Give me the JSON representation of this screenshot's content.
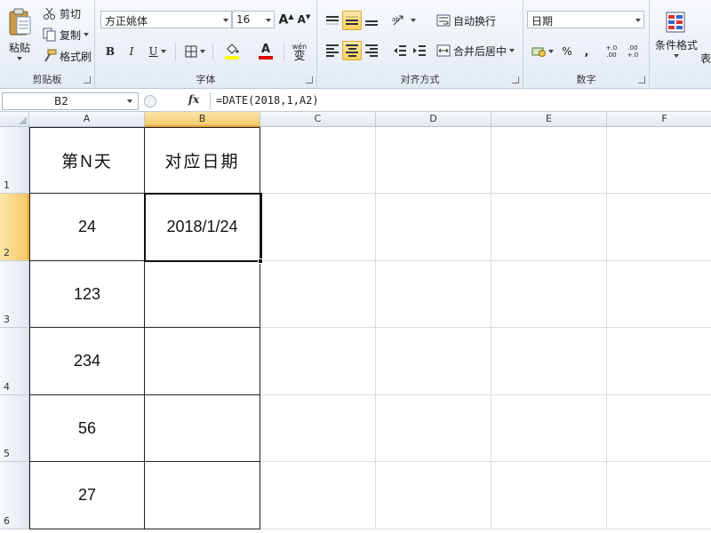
{
  "ribbon": {
    "clipboard": {
      "label": "剪贴板",
      "paste": "粘贴",
      "cut": "剪切",
      "copy": "复制",
      "format_painter": "格式刷"
    },
    "font": {
      "label": "字体",
      "font_name": "方正姚体",
      "font_size": "16",
      "bold": "B",
      "italic": "I",
      "underline": "U",
      "font_color": "A",
      "phonetic": "wén",
      "phonetic_char": "变"
    },
    "alignment": {
      "label": "对齐方式",
      "wrap_text": "自动换行",
      "merge_center": "合并后居中"
    },
    "number": {
      "label": "数字",
      "format": "日期",
      "percent": "%",
      "comma": ",",
      "inc_decimal": "+.0 .00",
      "dec_decimal": ".00 +.0"
    },
    "styles": {
      "conditional_format": "条件格式",
      "table_partial": "表"
    }
  },
  "formula_bar": {
    "name_box": "B2",
    "fx": "fx",
    "formula": "=DATE(2018,1,A2)"
  },
  "columns": [
    "A",
    "B",
    "C",
    "D",
    "E",
    "F"
  ],
  "rows": [
    {
      "num": "1",
      "a": "第N天",
      "b": "对应日期"
    },
    {
      "num": "2",
      "a": "24",
      "b": "2018/1/24"
    },
    {
      "num": "3",
      "a": "123",
      "b": ""
    },
    {
      "num": "4",
      "a": "234",
      "b": ""
    },
    {
      "num": "5",
      "a": "56",
      "b": ""
    },
    {
      "num": "6",
      "a": "27",
      "b": ""
    }
  ],
  "colors": {
    "selection_accent": "#f5c96a",
    "font_color_bar": "#e00000",
    "fill_color_bar": "#ffff00"
  }
}
